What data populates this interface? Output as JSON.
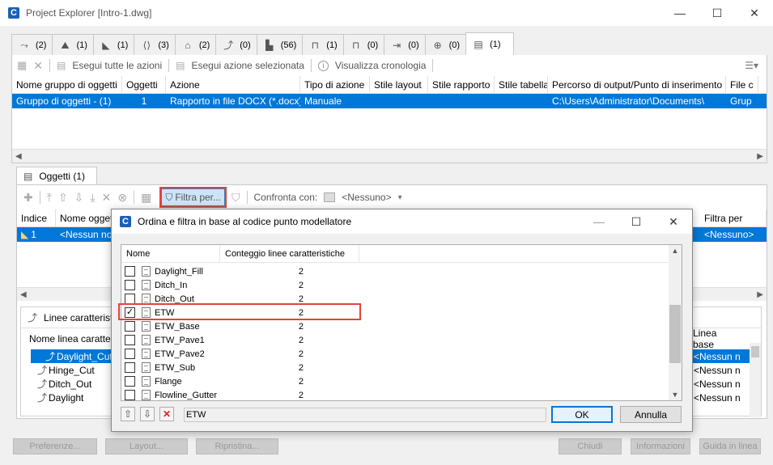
{
  "window": {
    "title": "Project Explorer [Intro-1.dwg]",
    "minimize": "—",
    "maximize": "☐",
    "close": "✕"
  },
  "tabs": [
    {
      "icon": "cogo-points-icon",
      "glyph": "⤳",
      "count": "(2)"
    },
    {
      "icon": "surfaces-icon",
      "glyph": "⛰",
      "count": "(1)"
    },
    {
      "icon": "alignments-icon",
      "glyph": "◣",
      "count": "(1)"
    },
    {
      "icon": "profiles-icon",
      "glyph": "⟨⟩",
      "count": "(3)"
    },
    {
      "icon": "sample-lines-icon",
      "glyph": "⌂",
      "count": "(2)"
    },
    {
      "icon": "feature-lines-icon",
      "glyph": "⤴",
      "count": "(0)"
    },
    {
      "icon": "corridors-icon",
      "glyph": "▙",
      "count": "(56)"
    },
    {
      "icon": "assemblies-icon",
      "glyph": "⊓",
      "count": "(1)"
    },
    {
      "icon": "subassemblies-icon",
      "glyph": "⊓",
      "count": "(0)"
    },
    {
      "icon": "pipe-networks-icon",
      "glyph": "⇥",
      "count": "(0)"
    },
    {
      "icon": "vehicles-icon",
      "glyph": "⊕",
      "count": "(0)"
    },
    {
      "icon": "object-sets-icon",
      "glyph": "▤",
      "count": "(1)"
    }
  ],
  "toolbar1": {
    "run_all": "Esegui tutte le azioni",
    "run_selected": "Esegui azione selezionata",
    "history": "Visualizza cronologia"
  },
  "grid1": {
    "headers": [
      "Nome gruppo di oggetti",
      "Oggetti",
      "Azione",
      "Tipo di azione",
      "Stile layout",
      "Stile rapporto",
      "Stile tabella",
      "Percorso di output/Punto di inserimento",
      "File c"
    ],
    "row": [
      "Gruppo di oggetti - (1)",
      "1",
      "Rapporto in file DOCX (*.docx)",
      "Manuale",
      "",
      "",
      "",
      "C:\\Users\\Administrator\\Documents\\",
      "Grup"
    ]
  },
  "objects_tab": "Oggetti (1)",
  "toolbar2": {
    "filter": "Filtra per...",
    "compare_label": "Confronta con:",
    "compare_value": "<Nessuno>"
  },
  "grid2": {
    "headers": [
      "Indice",
      "Nome oggett",
      "Filtra per"
    ],
    "row": [
      "1",
      "<Nessun no",
      "<Nessuno>"
    ]
  },
  "lines_panel": {
    "title": "Linee caratteristi",
    "col_name": "Nome linea caratteri",
    "col_base": "Linea base",
    "items": [
      "Daylight_Cut",
      "Hinge_Cut",
      "Ditch_Out",
      "Daylight"
    ],
    "base_values": [
      "<Nessun n",
      "<Nessun n",
      "<Nessun n",
      "<Nessun n"
    ]
  },
  "bottom_buttons": {
    "prefs": "Preferenze...",
    "layout": "Layout...",
    "restore": "Ripristina...",
    "close": "Chiudi",
    "info": "Informazioni",
    "help": "Guida in linea"
  },
  "dialog": {
    "title": "Ordina e filtra in base al codice punto modellatore",
    "col_name": "Nome",
    "col_count": "Conteggio linee caratteristiche",
    "items": [
      {
        "name": "Daylight_Fill",
        "count": "2",
        "checked": false
      },
      {
        "name": "Ditch_In",
        "count": "2",
        "checked": false
      },
      {
        "name": "Ditch_Out",
        "count": "2",
        "checked": false
      },
      {
        "name": "ETW",
        "count": "2",
        "checked": true
      },
      {
        "name": "ETW_Base",
        "count": "2",
        "checked": false
      },
      {
        "name": "ETW_Pave1",
        "count": "2",
        "checked": false
      },
      {
        "name": "ETW_Pave2",
        "count": "2",
        "checked": false
      },
      {
        "name": "ETW_Sub",
        "count": "2",
        "checked": false
      },
      {
        "name": "Flange",
        "count": "2",
        "checked": false
      },
      {
        "name": "Flowline_Gutter",
        "count": "2",
        "checked": false
      }
    ],
    "filter_text": "ETW",
    "ok": "OK",
    "cancel": "Annulla"
  }
}
